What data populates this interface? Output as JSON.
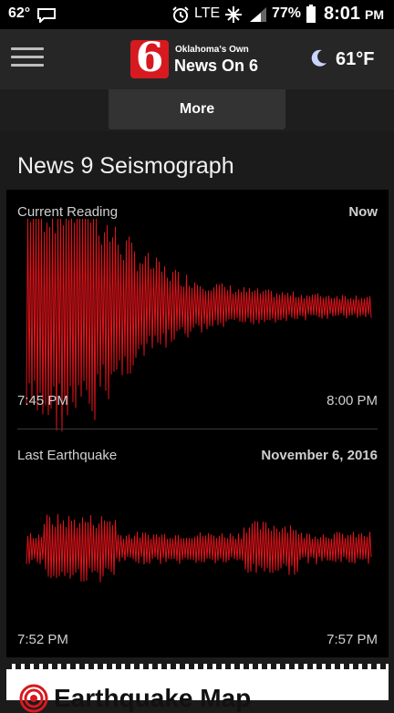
{
  "status_bar": {
    "temp": "62°",
    "network": "LTE",
    "battery": "77%",
    "time": "8:01",
    "ampm": "PM"
  },
  "header": {
    "logo_tagline": "Oklahoma's Own",
    "logo_name": "News On 6",
    "logo_number": "6",
    "temperature": "61°F",
    "weather_icon": "moon-icon"
  },
  "nav": {
    "more_label": "More"
  },
  "page": {
    "title": "News 9 Seismograph"
  },
  "seismograph": {
    "color": "#e0131a",
    "current": {
      "label": "Current Reading",
      "right_label": "Now",
      "start_time": "7:45 PM",
      "end_time": "8:00 PM"
    },
    "last_quake": {
      "label": "Last Earthquake",
      "date": "November 6, 2016",
      "start_time": "7:52 PM",
      "end_time": "7:57 PM"
    }
  },
  "map_section": {
    "title": "Earthquake Map"
  }
}
